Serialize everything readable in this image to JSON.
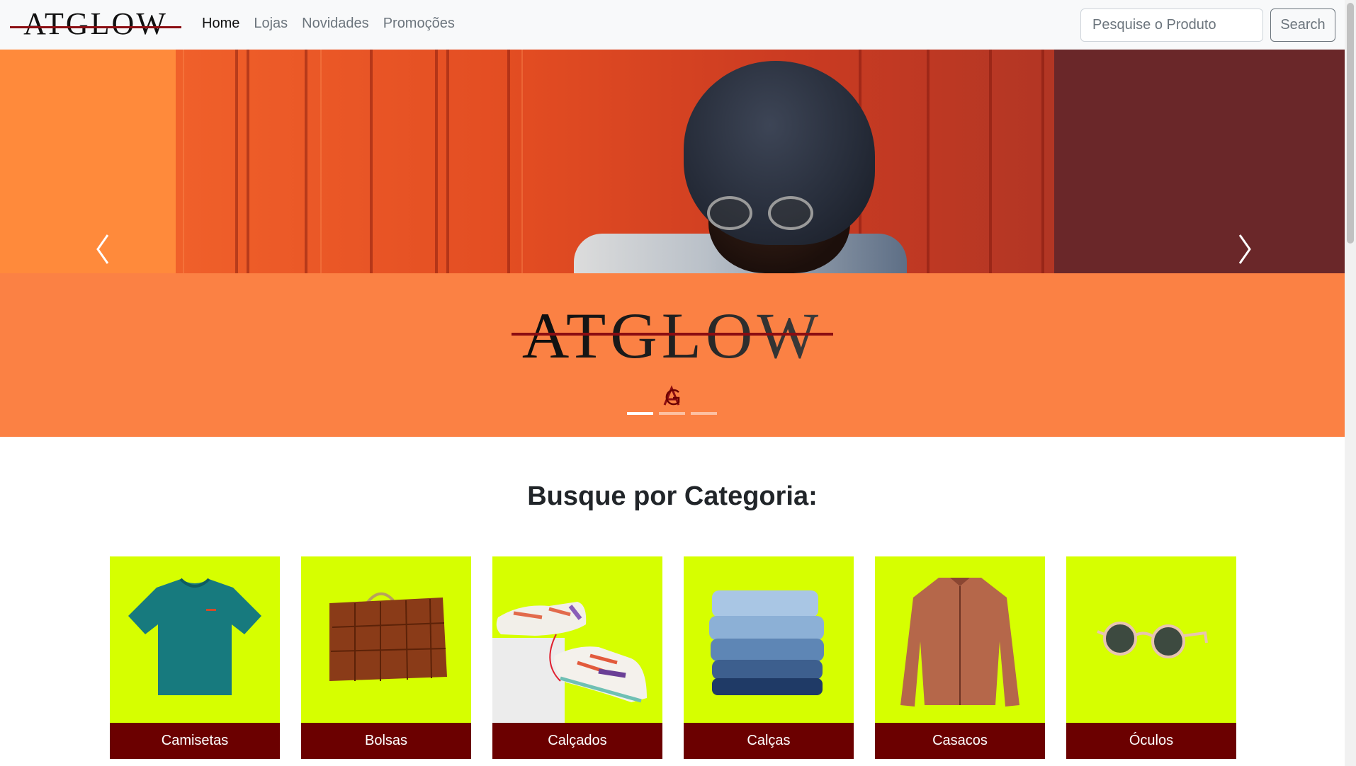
{
  "navbar": {
    "brand": "ATGLOW",
    "links": [
      {
        "label": "Home",
        "active": true
      },
      {
        "label": "Lojas",
        "active": false
      },
      {
        "label": "Novidades",
        "active": false
      },
      {
        "label": "Promoções",
        "active": false
      }
    ],
    "search": {
      "placeholder": "Pesquise o Produto",
      "button_label": "Search"
    }
  },
  "hero": {
    "logo_text": "ATGLOW",
    "slides_count": 3,
    "active_slide": 1,
    "colors": {
      "band": "#fb8144",
      "strike": "#8b0d12"
    }
  },
  "categories": {
    "title": "Busque por Categoria:",
    "items": [
      {
        "label": "Camisetas",
        "icon": "tshirt-icon"
      },
      {
        "label": "Bolsas",
        "icon": "handbag-icon"
      },
      {
        "label": "Calçados",
        "icon": "sneakers-icon"
      },
      {
        "label": "Calças",
        "icon": "jeans-icon"
      },
      {
        "label": "Casacos",
        "icon": "jacket-icon"
      },
      {
        "label": "Óculos",
        "icon": "sunglasses-icon"
      }
    ],
    "colors": {
      "card_bg": "#d6ff00",
      "label_bg": "#6b0000"
    }
  }
}
